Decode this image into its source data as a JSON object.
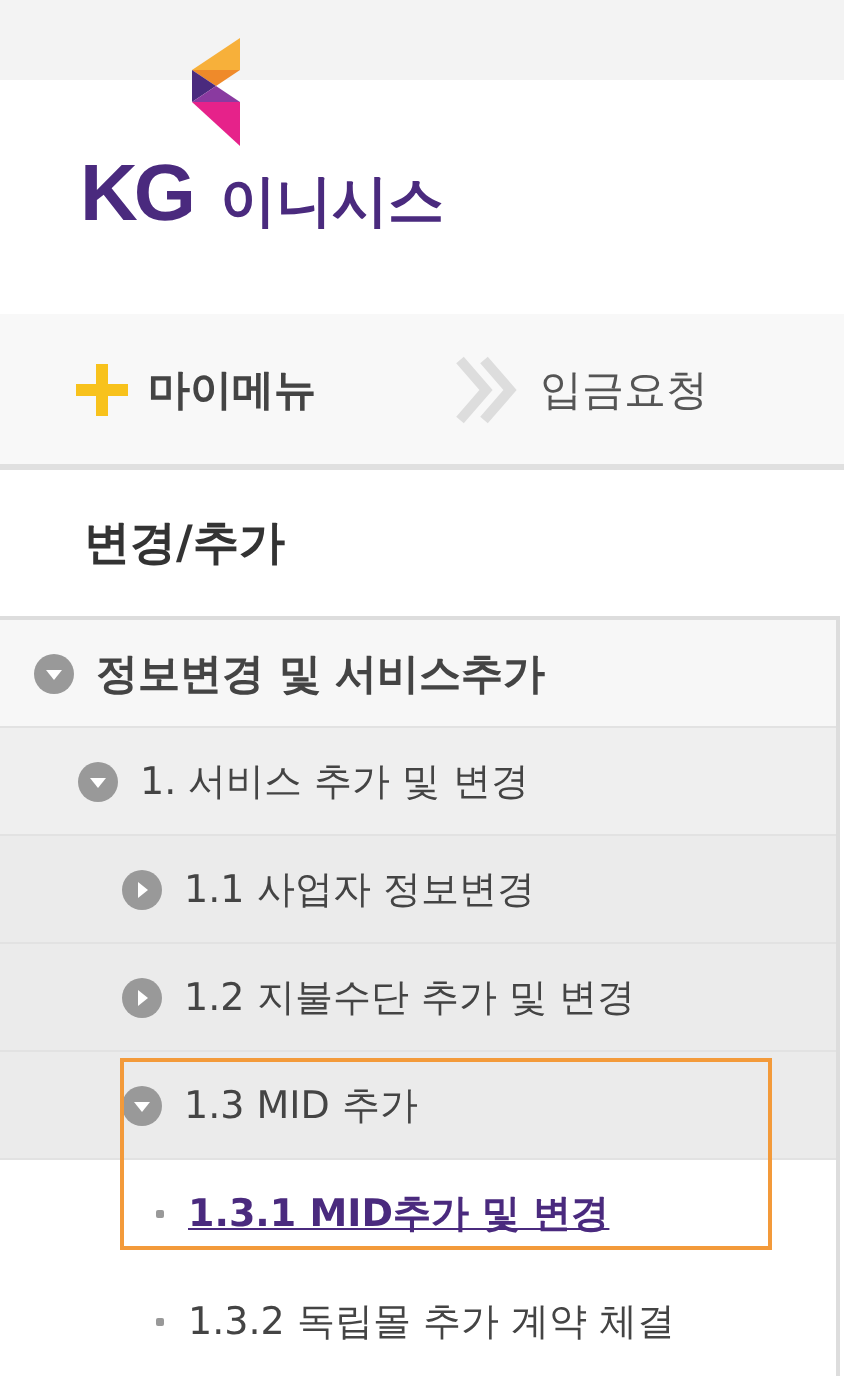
{
  "logo": {
    "mark": "KG",
    "name": "이니시스"
  },
  "nav": {
    "mymenu": "마이메뉴",
    "crumb": "입금요청"
  },
  "section_title": "변경/추가",
  "tree": [
    {
      "label": "정보변경 및 서비스추가",
      "expanded": true,
      "children": [
        {
          "label": "1. 서비스 추가 및 변경",
          "expanded": true,
          "children": [
            {
              "label": "1.1 사업자 정보변경",
              "expanded": false
            },
            {
              "label": "1.2 지불수단 추가 및 변경",
              "expanded": false
            },
            {
              "label": "1.3 MID 추가",
              "expanded": true,
              "highlighted": true,
              "children": [
                {
                  "label": "1.3.1 MID추가 및 변경",
                  "selected": true
                },
                {
                  "label": "1.3.2 독립몰 추가 계약 체결",
                  "selected": false
                }
              ]
            }
          ]
        }
      ]
    }
  ]
}
